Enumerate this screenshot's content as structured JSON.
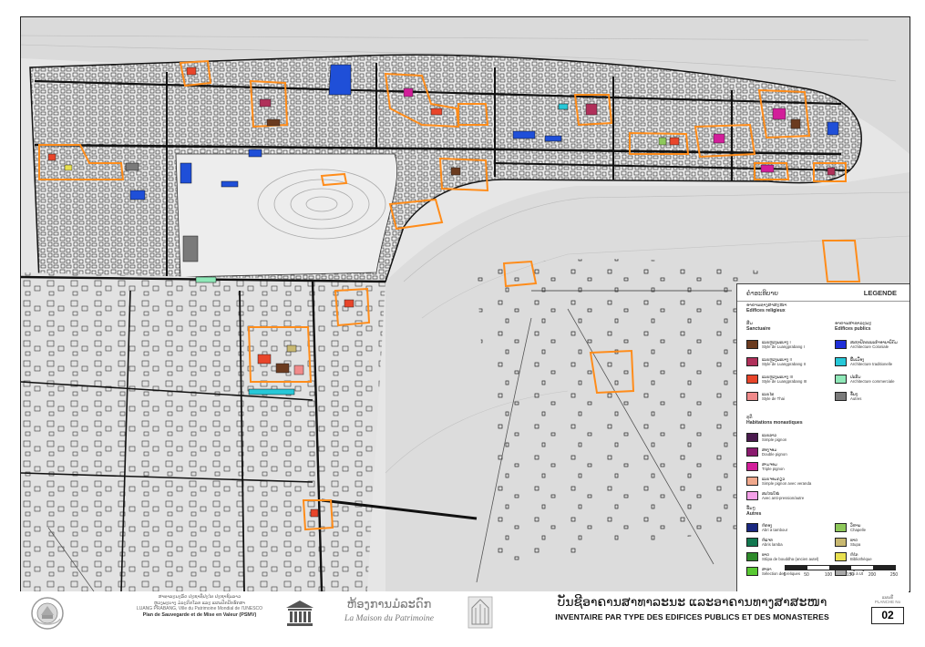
{
  "map": {
    "colors": {
      "background": "#e6e6e6",
      "river": "#d9d9d9",
      "parcel_outline": "#222222",
      "contour": "#a8a8a8",
      "monastery_boundary": "#ff8c1a",
      "public_building": "#1f4fd8"
    }
  },
  "legend": {
    "lao_title": "ຄຳອະທິບາຍ",
    "title": "LEGENDE",
    "religious": {
      "lao": "ອາຄານທາງສາສະໜາ",
      "label": "Edifices religieux"
    },
    "sanctuaire": {
      "lao": "ສິມ",
      "label": "Sanctuaire",
      "items": [
        {
          "lao": "ແບບຫຼວງພະບາງ I",
          "label": "Style de Luangprabang  I",
          "color": "#6b3b1f"
        },
        {
          "lao": "ແບບຫຼວງພະບາງ II",
          "label": "Style de Luangprabang  II",
          "color": "#b0305a"
        },
        {
          "lao": "ແບບຫຼວງພະບາງ III",
          "label": "Style de Luangprabang  III",
          "color": "#e8452a"
        },
        {
          "lao": "ແບບໄທ",
          "label": "Style de Thai",
          "color": "#f08a8a"
        }
      ]
    },
    "habitations": {
      "lao": "ກຸຕິ",
      "label": "Habitations monastiques",
      "items": [
        {
          "lao": "ແບບລາວ",
          "label": "Simple pignon",
          "color": "#4a1a4e"
        },
        {
          "lao": "ສອງຈອມ",
          "label": "Double pignon",
          "color": "#8a1a6e"
        },
        {
          "lao": "ສາມຈອມ",
          "label": "Triple pignon",
          "color": "#d21e9a"
        },
        {
          "lao": "ແບບຈອມດຽວ",
          "label": "Simple pignon avec veranda",
          "color": "#f0a88c"
        },
        {
          "lao": "ສະໄໝໃໝ່",
          "label": "Avec anti-pression/autre",
          "color": "#f4a0e8"
        }
      ]
    },
    "public": {
      "lao": "ອາຄານສາທາລະນະ",
      "label": "Edifices publics",
      "items": [
        {
          "lao": "ສະຖາປັດຕະຍະກຳອານານິຄົມ",
          "label": "Architecture Coloniale",
          "color": "#1f2fd8"
        },
        {
          "lao": "ພື້ນເມືອງ",
          "label": "Architecture traditionelle",
          "color": "#27c8d8"
        },
        {
          "lao": "ປະສົມ",
          "label": "Architecture commerciale",
          "color": "#8fe8b8"
        },
        {
          "lao": "ອື່ນໆ",
          "label": "Autres",
          "color": "#7a7a7a"
        }
      ]
    },
    "autres": {
      "lao": "ອື່ນໆ",
      "label": "Autres",
      "items": [
        {
          "lao": "ຫໍກອງ",
          "label": "Abri à tambour",
          "color": "#1a2880"
        },
        {
          "lao": "ຫໍແຈກ",
          "label": "Abris lamba",
          "color": "#127850"
        },
        {
          "lao": "ທາດ",
          "label": "Stûpa de bouddha (ancien autel)",
          "color": "#2e8a2a"
        },
        {
          "lao": "ສາລາ",
          "label": "Sélection des reliques",
          "color": "#58c832"
        },
        {
          "lao": "ວິຫານ",
          "label": "Chapelle",
          "color": "#8ec85a"
        },
        {
          "lao": "ທາດ",
          "label": "Stupa",
          "color": "#c8b870"
        },
        {
          "lao": "ຫໍໄຕ",
          "label": "Bibliothèque",
          "color": "#e8e050"
        },
        {
          "lao": "ສິ່ງກໍ່ສ້າງ",
          "label": "Ex à Ut",
          "color": "#a8a8a8"
        }
      ]
    },
    "scale": [
      "0",
      "50",
      "100",
      "150",
      "200",
      "250"
    ]
  },
  "footer": {
    "inst_lao_1": "ສາທາລະນະລັດ ປະຊາທິປະໄຕ ປະຊາຊົນລາວ",
    "inst_lao_2": "ຫຼວງພະບາງ ມໍລະດົກໂລກ ແລະ ແຜນປົກປັກຮັກສາ",
    "inst_fr_1": "LUANG PRABANG, Ville du Patrimoine Mondial de l'UNESCO",
    "inst_fr_2": "Plan de Sauvegarde et de Mise en Valeur (PSMV)",
    "maison_lao": "ຫ້ອງການມໍລະດົກ",
    "maison_fr": "La Maison du Patrimoine",
    "title_lao": "ບັນຊີອາຄານສາທາລະນະ ແລະອາຄານທາງສາສະໜາ",
    "title_fr": "INVENTAIRE PAR TYPE DES EDIFICES PUBLICS ET DES MONASTERES",
    "plate_lao": "ແຜນທີ່",
    "plate_label": "PLANCHE No",
    "plate_num": "02"
  }
}
